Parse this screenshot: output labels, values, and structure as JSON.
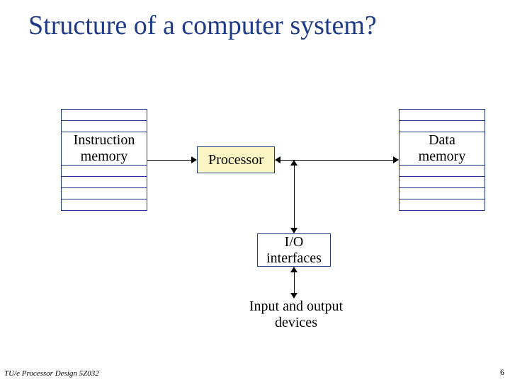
{
  "title": "Structure of a computer system?",
  "blocks": {
    "instruction_memory": "Instruction\nmemory",
    "processor": "Processor",
    "data_memory": "Data\nmemory",
    "io_interfaces": "I/O\ninterfaces",
    "io_devices": "Input and output\ndevices"
  },
  "footer": "TU/e  Processor Design 5Z032",
  "page_number": "6"
}
